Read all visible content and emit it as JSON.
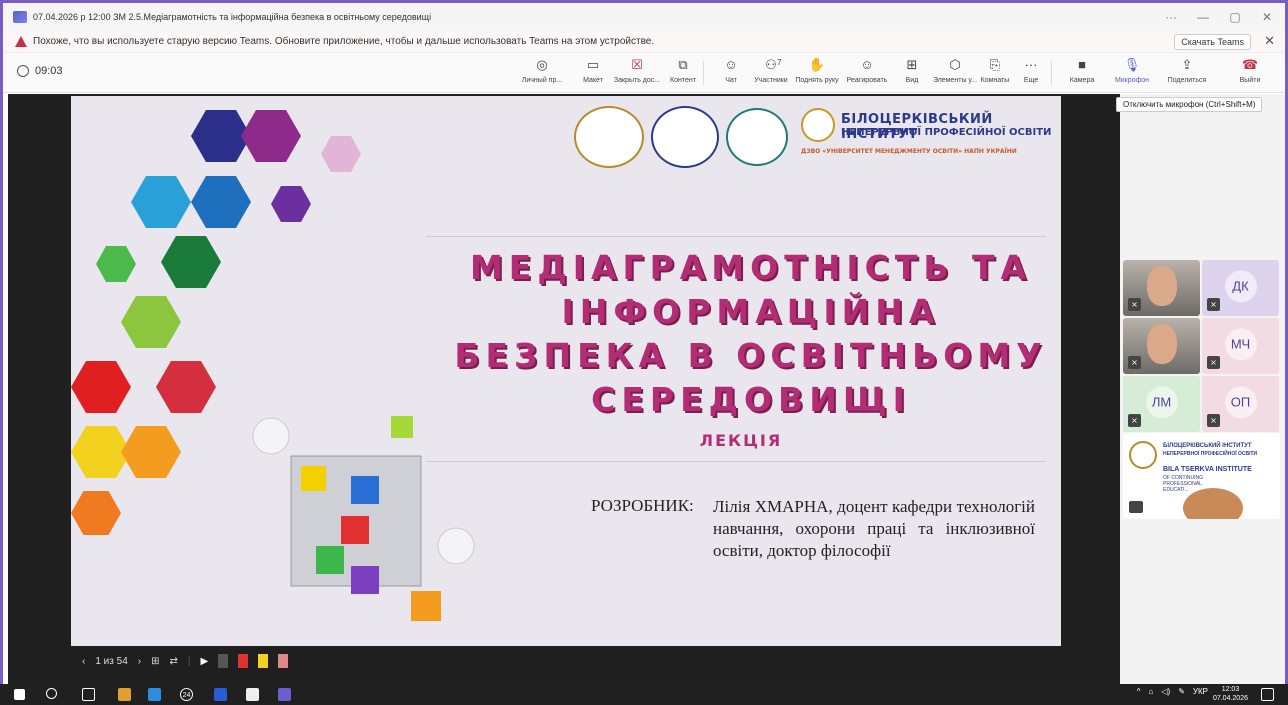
{
  "window": {
    "title": "07.04.2026 р 12:00 ЗМ 2.5.Медіаграмотність та інформаційна безпека в освітньому середовищі",
    "controls": [
      "···",
      "—",
      "▢",
      "✕"
    ]
  },
  "banner": {
    "message": "Похоже, что вы используете старую версию Teams. Обновите приложение, чтобы и дальше использовать Teams на этом устройстве.",
    "download_label": "Скачать Teams",
    "close": "✕"
  },
  "toolbar": {
    "timer": "09:03",
    "buttons": [
      {
        "label": "Личный пр...",
        "icon": "◎"
      },
      {
        "label": "Макет",
        "icon": "▭"
      },
      {
        "label": "Закрыть дос...",
        "icon": "☒"
      },
      {
        "label": "Контент",
        "icon": "⧉"
      },
      {
        "label": "Чат",
        "icon": "☺"
      },
      {
        "label": "Участники",
        "icon": "⚇",
        "count": "7"
      },
      {
        "label": "Поднять руку",
        "icon": "✋"
      },
      {
        "label": "Реагировать",
        "icon": "☺"
      },
      {
        "label": "Вид",
        "icon": "⊞"
      },
      {
        "label": "Элементы у...",
        "icon": "⬡"
      },
      {
        "label": "Комнаты",
        "icon": "⎘"
      },
      {
        "label": "Еще",
        "icon": "···"
      },
      {
        "label": "Камера",
        "icon": "■"
      },
      {
        "label": "Микрофон",
        "icon": "🎙"
      },
      {
        "label": "Поделиться",
        "icon": "⇪"
      },
      {
        "label": "Выйти",
        "icon": "☎"
      }
    ],
    "tooltip": "Отключить микрофон (Ctrl+Shift+M)"
  },
  "slide": {
    "institute_name": "БІЛОЦЕРКІВСЬКИЙ ІНСТИТУТ",
    "institute_sub": "НЕПЕРЕРВНОЇ ПРОФЕСІЙНОЇ ОСВІТИ",
    "institute_sub2": "ДЗВО «УНІВЕРСИТЕТ МЕНЕДЖМЕНТУ ОСВІТИ» НАПН УКРАЇНИ",
    "title_lines": [
      "МЕДІАГРАМОТНІСТЬ ТА",
      "ІНФОРМАЦІЙНА",
      "БЕЗПЕКА В ОСВІТНЬОМУ",
      "СЕРЕДОВИЩІ"
    ],
    "subtitle": "ЛЕКЦІЯ",
    "author_label": "РОЗРОБНИК:",
    "author_text": "Лілія ХМАРНА, доцент кафедри технологій навчання, охорони праці та інклюзивної освіти, доктор філософії"
  },
  "slide_controls": {
    "page": "1 из 54"
  },
  "participants": [
    {
      "type": "video"
    },
    {
      "type": "initials",
      "initials": "ДК",
      "color": "#ddd3ec"
    },
    {
      "type": "video"
    },
    {
      "type": "initials",
      "initials": "МЧ",
      "color": "#f3dbe3"
    },
    {
      "type": "initials",
      "initials": "ЛМ",
      "color": "#d6ecd6"
    },
    {
      "type": "initials",
      "initials": "ОП",
      "color": "#f3dbe3"
    }
  ],
  "share_tile": {
    "line1": "БІЛОЦЕРКІВСЬКИЙ ІНСТИТУТ",
    "line2": "НЕПЕРЕРВНОЇ ПРОФЕСІЙНОЇ ОСВІТИ",
    "line3": "BILA TSERKVA INSTITUTE",
    "line4": "OF CONTINUING PROFESSIONAL EDUCATI..."
  },
  "taskbar": {
    "lang": "УКР",
    "time": "12:03",
    "date": "07.04.2026",
    "badge": "24"
  }
}
